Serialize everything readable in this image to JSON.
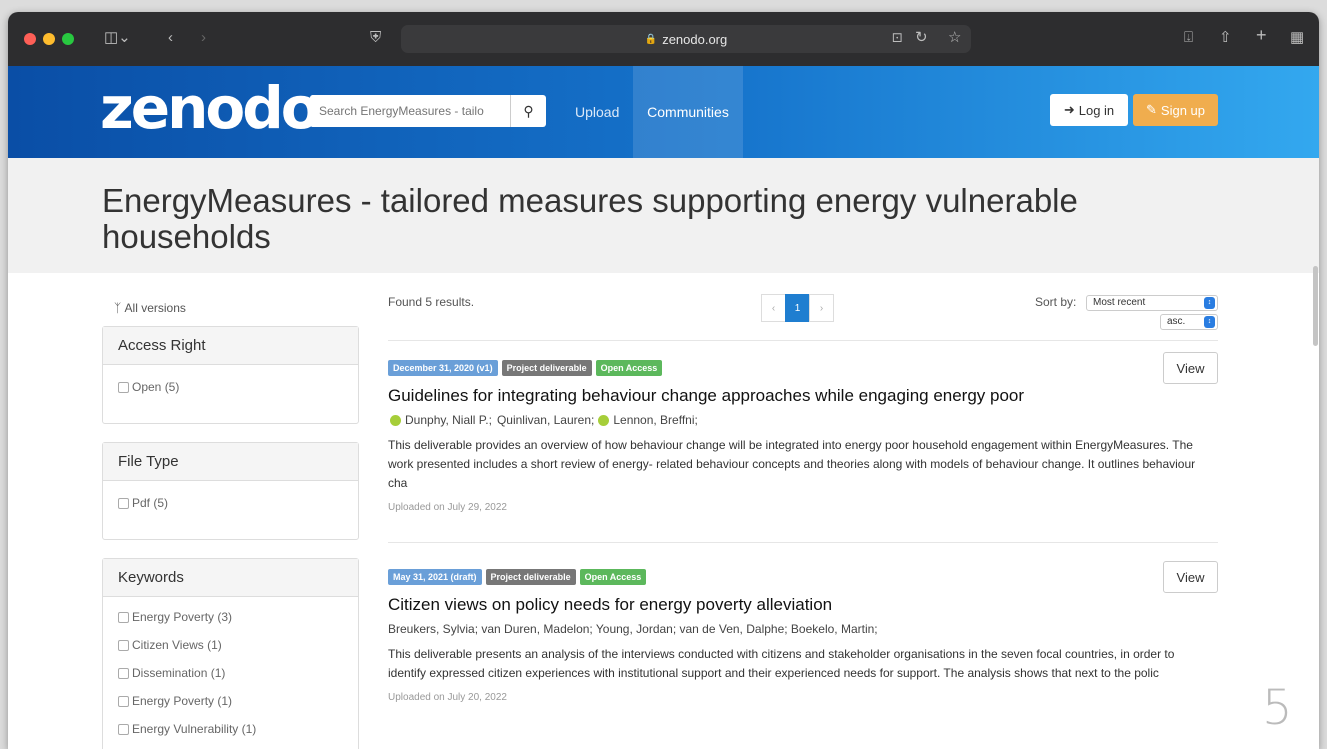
{
  "browser": {
    "url": "zenodo.org",
    "lights": {
      "close": "#fe5f57",
      "minimize": "#febc2e",
      "zoom": "#28c840"
    }
  },
  "header": {
    "logo": "zenodo",
    "search_placeholder": "Search EnergyMeasures - tailo",
    "nav_upload": "Upload",
    "nav_communities": "Communities",
    "login_label": "Log in",
    "signup_label": "Sign up"
  },
  "page_title": "EnergyMeasures - tailored measures supporting energy vulnerable households",
  "sidebar": {
    "all_versions": "All versions",
    "facets": [
      {
        "title": "Access Right",
        "items": [
          "Open (5)"
        ]
      },
      {
        "title": "File Type",
        "items": [
          "Pdf (5)"
        ]
      },
      {
        "title": "Keywords",
        "items": [
          "Energy Poverty (3)",
          "Citizen Views (1)",
          "Dissemination (1)",
          "Energy Poverty (1)",
          "Energy Vulnerability (1)"
        ]
      }
    ]
  },
  "results": {
    "found": "Found 5 results.",
    "pager": {
      "prev": "‹",
      "current": "1",
      "next": "›"
    },
    "sort_label": "Sort by:",
    "sort_value": "Most recent",
    "order_value": "asc.",
    "view_label": "View",
    "records": [
      {
        "badges": [
          {
            "text": "December 31, 2020 (v1)",
            "color": "#6a9fd8"
          },
          {
            "text": "Project deliverable",
            "color": "#777777"
          },
          {
            "text": "Open Access",
            "color": "#5cb85c"
          }
        ],
        "title": "Guidelines for integrating behaviour change approaches while engaging energy poor",
        "authors": [
          {
            "name": "Dunphy, Niall P.;",
            "orcid": true
          },
          {
            "name": "Quinlivan, Lauren;",
            "orcid": false
          },
          {
            "name": "Lennon, Breffni;",
            "orcid": true
          }
        ],
        "description": "This deliverable provides an overview of how behaviour change will be integrated into energy poor household engagement within EnergyMeasures. The work presented includes a short review of energy- related behaviour concepts and theories along with models of behaviour change. It outlines behaviour cha",
        "uploaded": "Uploaded on July 29, 2022"
      },
      {
        "badges": [
          {
            "text": "May 31, 2021 (draft)",
            "color": "#6a9fd8"
          },
          {
            "text": "Project deliverable",
            "color": "#777777"
          },
          {
            "text": "Open Access",
            "color": "#5cb85c"
          }
        ],
        "title": "Citizen views on policy needs for energy poverty alleviation",
        "authors": [
          {
            "name": "Breukers, Sylvia; van Duren, Madelon; Young, Jordan; van de Ven, Dalphe; Boekelo, Martin;",
            "orcid": false
          }
        ],
        "description": "This deliverable presents an analysis of the interviews conducted with citizens and stakeholder organisations in the seven focal countries, in order to identify expressed citizen experiences with institutional support and their experienced needs for support. The analysis shows that next to the polic",
        "uploaded": "Uploaded on July 20, 2022"
      }
    ]
  },
  "slide_number": "5"
}
